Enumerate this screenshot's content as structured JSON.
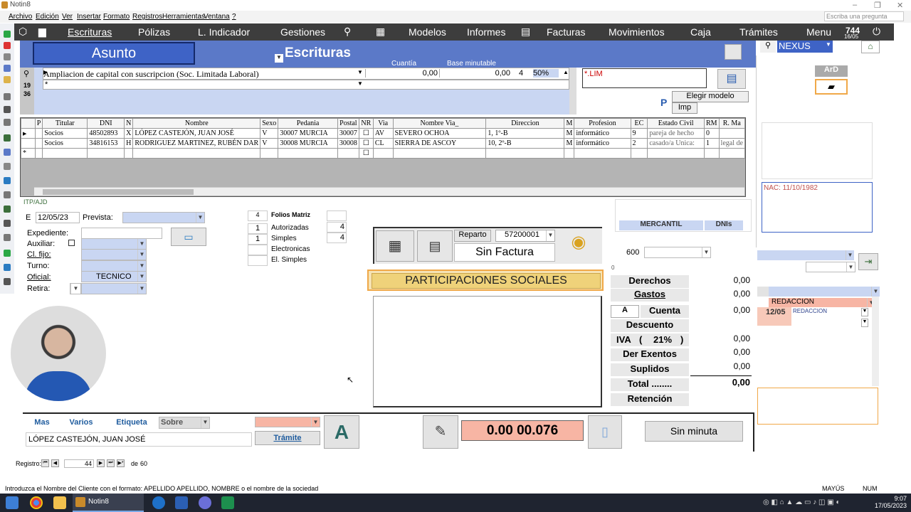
{
  "window": {
    "title": "Notin8",
    "controls": [
      "–",
      "❐",
      "✕"
    ]
  },
  "menu": {
    "items": [
      "Archivo",
      "Edición",
      "Ver",
      "Insertar",
      "Formato",
      "Registros",
      "Herramientas",
      "Ventana",
      "?"
    ],
    "ask_placeholder": "Escriba una pregunta"
  },
  "nav": {
    "items": [
      "Escrituras",
      "Pólizas",
      "L. Indicador",
      "Gestiones",
      "Modelos",
      "Informes",
      "Facturas",
      "Movimientos",
      "Caja",
      "Trámites",
      "Menu"
    ],
    "counter": "744",
    "date": "16/05"
  },
  "header": {
    "asunto": "Asunto",
    "section": "Escrituras",
    "cuantia_label": "Cuantía",
    "base_label": "Base minutable",
    "nexus": "NEXUS",
    "ard": "ArD"
  },
  "acts": {
    "row_numbers": [
      "19",
      "36"
    ],
    "description": "Ampliacion de capital con suscripcion (Soc. Limitada Laboral)",
    "cuantia": "0,00",
    "base": "0,00",
    "count": "4",
    "percent": "50%",
    "new_row_marker": "*"
  },
  "lim": "*.LIM",
  "buttons": {
    "elegir_modelo": "Elegir modelo",
    "imp": "Imp",
    "p_label": "P",
    "tramite": "Trámite",
    "sin_minuta": "Sin minuta",
    "big_a": "A"
  },
  "grid": {
    "columns": [
      "P",
      "Titular",
      "DNI",
      "N",
      "Nombre",
      "Sexo",
      "Pedania",
      "Postal",
      "NR",
      "Via",
      "Nombre Via_",
      "Direccion",
      "M",
      "Profesion",
      "EC",
      "Estado Civil",
      "RM",
      "R. Ma"
    ],
    "rows": [
      [
        "",
        "Socios",
        "48502893",
        "X",
        "LÓPEZ CASTEJÓN, JUAN JOSÉ",
        "V",
        "30007 MURCIA",
        "30007",
        "",
        "AV",
        "SEVERO OCHOA",
        "1, 1º-B",
        "M",
        "informático",
        "9",
        "pareja de hecho",
        "0",
        ""
      ],
      [
        "",
        "Socios",
        "34816153",
        "H",
        "RODRIGUEZ MARTINEZ, RUBÉN DAR",
        "V",
        "30008 MURCIA",
        "30008",
        "",
        "CL",
        "SIERRA DE ASCOY",
        "10, 2º-B",
        "M",
        "informático",
        "2",
        "casado/a  Unica:",
        "1",
        "legal de"
      ]
    ],
    "new_row_marker": "*"
  },
  "itp": "ITP/AJD",
  "form": {
    "e_label": "E",
    "fecha": "12/05/23",
    "prevista_label": "Prevista:",
    "expediente_label": "Expediente:",
    "auxiliar_label": "Auxiliar:",
    "clfijo_label": "Cl. fijo:",
    "turno_label": "Turno:",
    "oficial_label": "Oficial:",
    "oficial_value": "TECNICO",
    "retira_label": "Retira:"
  },
  "folios": {
    "matriz_count": "4",
    "matriz_label": "Folios Matriz",
    "autorizadas_label": "Autorizadas",
    "autorizadas_left": "1",
    "autorizadas_right": "4",
    "simples_label": "Simples",
    "simples_left": "1",
    "simples_right": "4",
    "electronicas_label": "Electronicas",
    "elsimples_label": "El. Simples"
  },
  "factura": {
    "reparto": "Reparto",
    "reparto_num": "57200001",
    "status": "Sin Factura"
  },
  "participaciones": "PARTICIPACIONES SOCIALES",
  "side": {
    "mercantil": "MERCANTIL",
    "dnis": "DNIs",
    "code": "600",
    "zero": "0",
    "nac": "NAC: 11/10/1982"
  },
  "totals": {
    "derechos_label": "Derechos",
    "derechos": "0,00",
    "gastos_label": "Gastos",
    "gastos": "0,00",
    "a_label": "A",
    "cuenta_label": "Cuenta",
    "cuenta": "0,00",
    "descuento_label": "Descuento",
    "iva_label": "IVA",
    "iva_open": "(",
    "iva_pct": "21%",
    "iva_close": ")",
    "iva": "0,00",
    "exentos_label": "Der Exentos",
    "exentos": "0,00",
    "suplidos_label": "Suplidos",
    "suplidos": "0,00",
    "total_label": "Total ........",
    "total": "0,00",
    "retencion_label": "Retención"
  },
  "redaccion": {
    "label": "REDACCION",
    "date": "12/05",
    "sub": "REDACCION"
  },
  "bottom": {
    "tabs": [
      "Mas",
      "Varios",
      "Etiqueta",
      "Sobre"
    ],
    "nombre": "LÓPEZ CASTEJÓN, JUAN JOSÉ",
    "codigo": "0.00 00.076"
  },
  "record": {
    "label": "Registro:",
    "current": "44",
    "of": "de",
    "total": "60"
  },
  "status": {
    "hint": "Introduzca el Nombre del  Cliente con el formato: APELLIDO APELLIDO, NOMBRE o el nombre de la sociedad",
    "mayus": "MAYÚS",
    "num": "NUM"
  },
  "taskbar": {
    "app": "Notin8",
    "time": "9:07",
    "date": "17/05/2023"
  }
}
